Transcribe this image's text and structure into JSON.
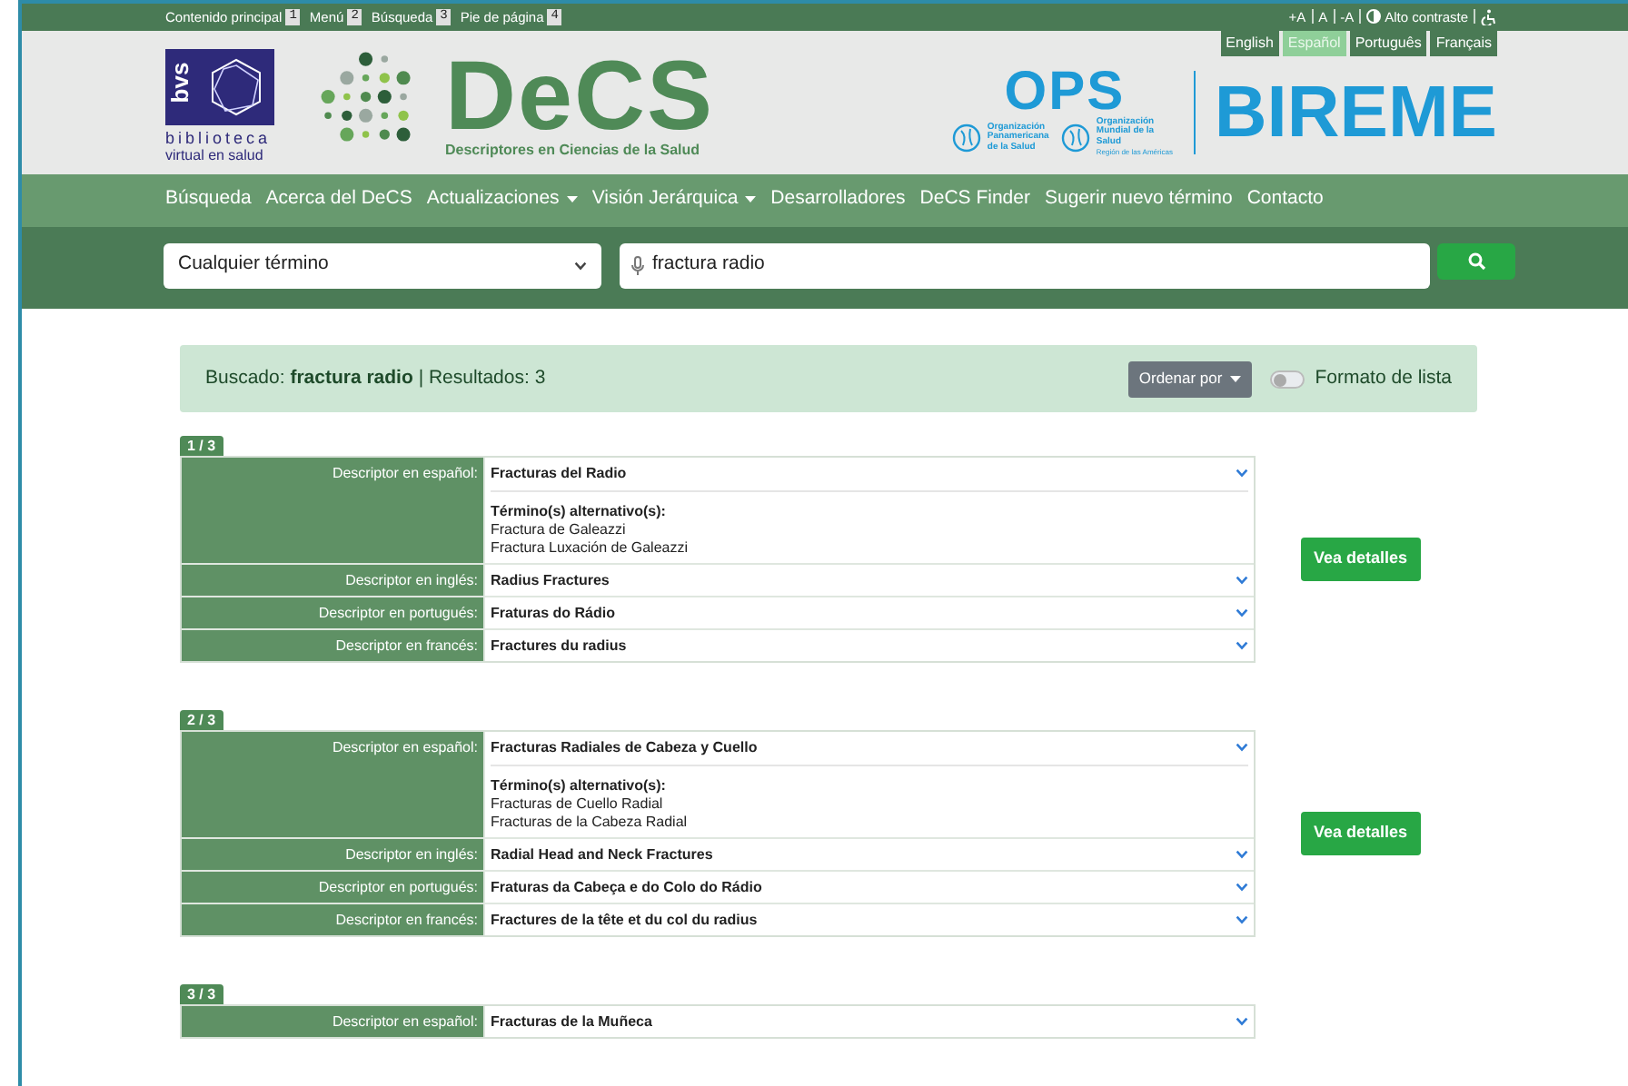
{
  "skip_links": [
    {
      "label": "Contenido principal",
      "key": "1"
    },
    {
      "label": "Menú",
      "key": "2"
    },
    {
      "label": "Búsqueda",
      "key": "3"
    },
    {
      "label": "Pie de página",
      "key": "4"
    }
  ],
  "accessibility": {
    "font_controls": [
      "+A",
      "A",
      "-A"
    ],
    "contrast": "Alto contraste"
  },
  "languages": [
    {
      "label": "English",
      "selected": false
    },
    {
      "label": "Español",
      "selected": true
    },
    {
      "label": "Português",
      "selected": false
    },
    {
      "label": "Français",
      "selected": false
    }
  ],
  "logos": {
    "bvs": {
      "mark": "bvs",
      "line1": "biblioteca",
      "line2": "virtual en salud"
    },
    "decs": {
      "title": "DeCS",
      "subtitle": "Descriptores en Ciencias de la Salud"
    },
    "ops": {
      "title": "OPS",
      "org1": "Organización Panamericana de la Salud",
      "org2": "Organización Mundial de la Salud",
      "region": "Región de las Américas"
    },
    "bireme": "BIREME"
  },
  "nav": [
    {
      "label": "Búsqueda",
      "dropdown": false
    },
    {
      "label": "Acerca del DeCS",
      "dropdown": false
    },
    {
      "label": "Actualizaciones",
      "dropdown": true
    },
    {
      "label": "Visión Jerárquica",
      "dropdown": true
    },
    {
      "label": "Desarrolladores",
      "dropdown": false
    },
    {
      "label": "DeCS Finder",
      "dropdown": false
    },
    {
      "label": "Sugerir nuevo término",
      "dropdown": false
    },
    {
      "label": "Contacto",
      "dropdown": false
    }
  ],
  "search": {
    "scope": "Cualquier término",
    "query": "fractura radio"
  },
  "summary": {
    "prefix": "Buscado:",
    "term": "fractura radio",
    "results": "| Resultados: 3",
    "sort": "Ordenar por",
    "list_format": {
      "label": "Formato de lista",
      "on": false
    }
  },
  "results": [
    {
      "badge": "1 / 3",
      "rows": [
        {
          "label": "Descriptor en español:",
          "value": "Fracturas del Radio",
          "alt_title": "Término(s) alternativo(s):",
          "alternatives": [
            "Fractura de Galeazzi",
            "Fractura Luxación de Galeazzi"
          ]
        },
        {
          "label": "Descriptor en inglés:",
          "value": "Radius Fractures"
        },
        {
          "label": "Descriptor en portugués:",
          "value": "Fraturas do Rádio"
        },
        {
          "label": "Descriptor en francés:",
          "value": "Fractures du radius"
        }
      ],
      "button": "Vea detalles"
    },
    {
      "badge": "2 / 3",
      "rows": [
        {
          "label": "Descriptor en español:",
          "value": "Fracturas Radiales de Cabeza y Cuello",
          "alt_title": "Término(s) alternativo(s):",
          "alternatives": [
            "Fracturas de Cuello Radial",
            "Fracturas de la Cabeza Radial"
          ]
        },
        {
          "label": "Descriptor en inglés:",
          "value": "Radial Head and Neck Fractures"
        },
        {
          "label": "Descriptor en portugués:",
          "value": "Fraturas da Cabeça e do Colo do Rádio"
        },
        {
          "label": "Descriptor en francés:",
          "value": "Fractures de la tête et du col du radius"
        }
      ],
      "button": "Vea detalles"
    },
    {
      "badge": "3 / 3",
      "rows": [
        {
          "label": "Descriptor en español:",
          "value": "Fracturas de la Muñeca"
        }
      ]
    }
  ]
}
